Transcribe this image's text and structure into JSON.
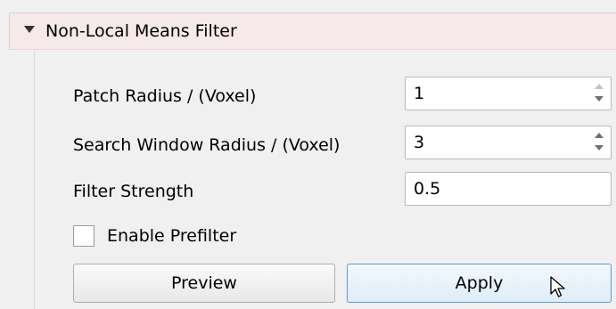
{
  "section": {
    "title": "Non-Local Means Filter"
  },
  "params": {
    "patch_radius": {
      "label": "Patch Radius / (Voxel)",
      "value": "1"
    },
    "search_window_radius": {
      "label": "Search Window Radius / (Voxel)",
      "value": "3"
    },
    "filter_strength": {
      "label": "Filter Strength",
      "value": "0.5"
    },
    "enable_prefilter": {
      "label": "Enable Prefilter",
      "checked": false
    }
  },
  "buttons": {
    "preview_label": "Preview",
    "apply_label": "Apply"
  },
  "icons": {
    "collapse": "triangle-down-icon",
    "spinner": "spinbox-arrows-icon",
    "cursor": "mouse-pointer-icon"
  },
  "colors": {
    "header_background": "#f6e9e9",
    "panel_background": "#f0f0f0",
    "apply_border": "#5b9bd5"
  }
}
